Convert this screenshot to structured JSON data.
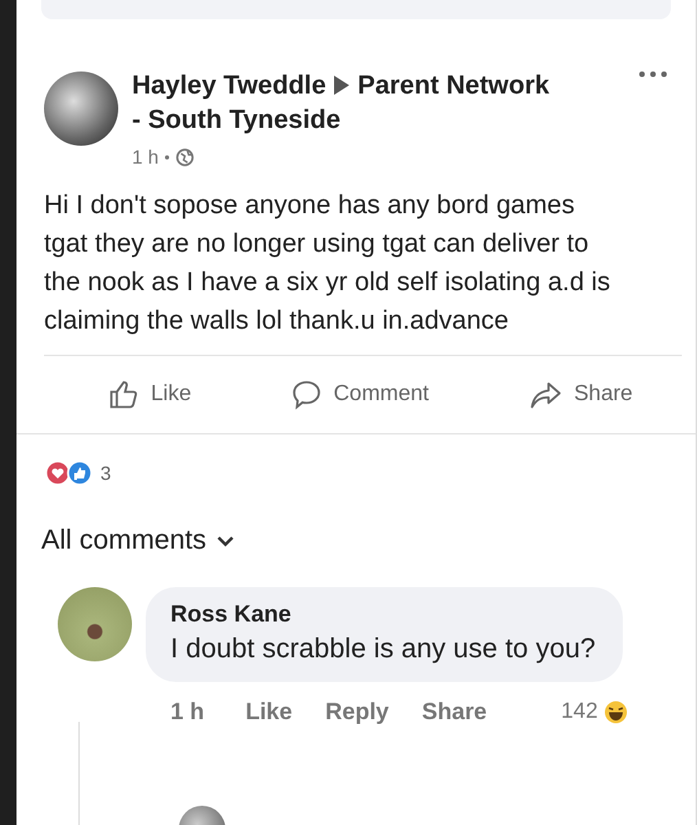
{
  "post": {
    "author": "Hayley Tweddle",
    "group": "Parent Network",
    "group_line2": "- South Tyneside",
    "time": "1 h",
    "body": "Hi I don't sopose anyone has any bord games tgat they are no longer using tgat can deliver to the nook as I have a six yr old self isolating a.d is claiming the walls lol  thank.u in.advance"
  },
  "actions": [
    {
      "label": "Like",
      "kind": "like"
    },
    {
      "label": "Comment",
      "kind": "comment"
    },
    {
      "label": "Share",
      "kind": "share"
    }
  ],
  "reactions": {
    "count": "3"
  },
  "comments_filter": {
    "label": "All comments"
  },
  "comments": [
    {
      "author": "Ross Kane",
      "text": "I doubt scrabble is any use to you?",
      "time": "1 h",
      "actions": [
        "Like",
        "Reply",
        "Share"
      ],
      "reaction_count": "142"
    }
  ]
}
